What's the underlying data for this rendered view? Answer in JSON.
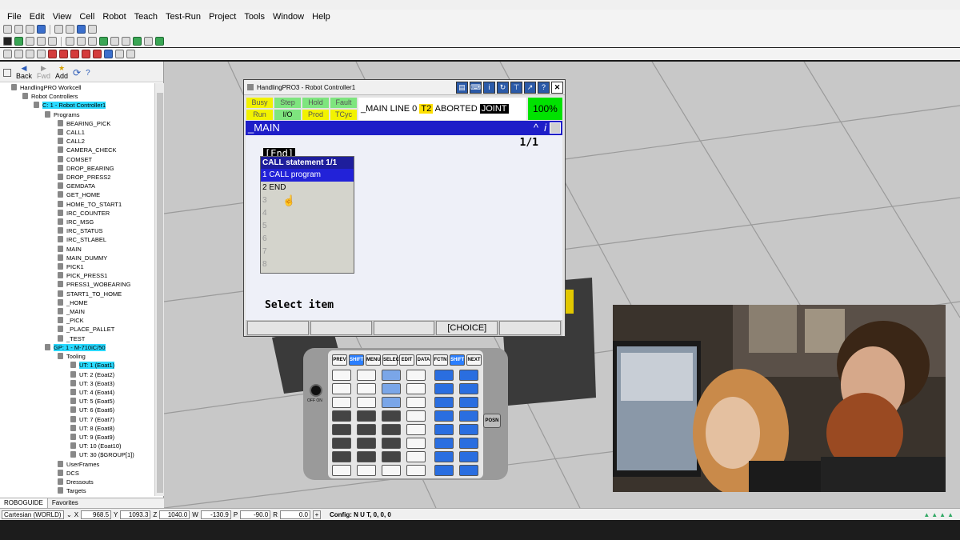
{
  "menu": [
    "File",
    "Edit",
    "View",
    "Cell",
    "Robot",
    "Teach",
    "Test-Run",
    "Project",
    "Tools",
    "Window",
    "Help"
  ],
  "nav": {
    "back": "Back",
    "fwd": "Fwd",
    "add": "Add"
  },
  "tree": {
    "workcell": "HandlingPRO Workcell",
    "controllers": "Robot Controllers",
    "controller": "C: 1 - Robot Controller1",
    "programs_label": "Programs",
    "programs": [
      "BEARING_PICK",
      "CALL1",
      "CALL2",
      "CAMERA_CHECK",
      "COMSET",
      "DROP_BEARING",
      "DROP_PRESS2",
      "GEMDATA",
      "GET_HOME",
      "HOME_TO_START1",
      "IRC_COUNTER",
      "IRC_MSG",
      "IRC_STATUS",
      "IRC_STLABEL",
      "MAIN",
      "MAIN_DUMMY",
      "PICK1",
      "PICK_PRESS1",
      "PRESS1_WOBEARING",
      "START1_TO_HOME",
      "_HOME",
      "_MAIN",
      "_PICK",
      "_PLACE_PALLET",
      "_TEST"
    ],
    "group": "GP: 1 - M-710iC/50",
    "tooling_label": "Tooling",
    "tooling": [
      "UT: 1  (Eoat1)",
      "UT: 2  (Eoat2)",
      "UT: 3  (Eoat3)",
      "UT: 4  (Eoat4)",
      "UT: 5  (Eoat5)",
      "UT: 6  (Eoat6)",
      "UT: 7  (Eoat7)",
      "UT: 8  (Eoat8)",
      "UT: 9  (Eoat9)",
      "UT: 10  (Eoat10)",
      "UT: 30  ($GROUP[1])"
    ],
    "after": [
      "UserFrames",
      "DCS",
      "Dressouts",
      "Targets"
    ]
  },
  "tabs": {
    "a": "ROBOGUIDE",
    "b": "Favorites"
  },
  "tp": {
    "title": "HandlingPRO3 - Robot Controller1",
    "status": {
      "busy": "Busy",
      "step": "Step",
      "hold": "Hold",
      "fault": "Fault",
      "run": "Run",
      "io": "I/O",
      "prod": "Prod",
      "tcyc": "TCyc"
    },
    "line": "_MAIN LINE 0",
    "t2": "T2",
    "aborted": "ABORTED",
    "joint": "JOINT",
    "pct": "100%",
    "prog": "_MAIN",
    "page": "1/1",
    "end": "[End]",
    "popup_header": "CALL statement  1/1",
    "popup_items": [
      "1 CALL program",
      "2 END",
      "3",
      "4",
      "5",
      "6",
      "7",
      "8"
    ],
    "select": "Select item",
    "fkeys": [
      "",
      "",
      "",
      "[CHOICE]",
      ""
    ]
  },
  "pendant": {
    "row1": [
      "PREV",
      "SHIFT",
      "MENU",
      "SELECT",
      "EDIT",
      "DATA",
      "FCTN",
      "SHIFT",
      "NEXT"
    ],
    "posn": "POSN",
    "off_on": "OFF  ON"
  },
  "status": {
    "coord": "Cartesian (WORLD)",
    "X": "968.5",
    "Y": "1093.3",
    "Z": "1040.0",
    "W": "-130.9",
    "P": "-90.0",
    "R": "0.0",
    "config": "Config: N U T, 0, 0, 0"
  },
  "colors": {
    "selection": "#2ad9ff",
    "tp_blue": "#1e1ec8",
    "run_green": "#00e200"
  }
}
